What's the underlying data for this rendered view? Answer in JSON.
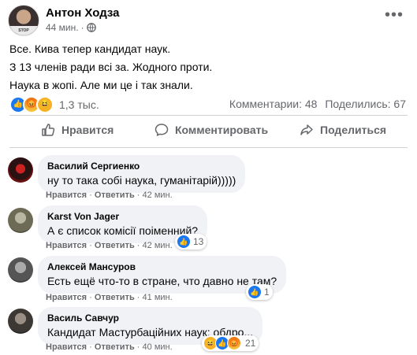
{
  "post": {
    "author": "Антон Ходза",
    "time": "44 мин.",
    "avatar_caption": "STOP TRANSPORT",
    "lines": [
      "Все. Кива тепер кандидат наук.",
      "З 13 членів ради всі за. Жодного проти.",
      "Наука в жопі. Але ми це і так знали."
    ],
    "reactions_count": "1,3 тыс.",
    "comments_count": "Комментарии: 48",
    "shares_count": "Поделились: 67",
    "actions": {
      "like": "Нравится",
      "comment": "Комментировать",
      "share": "Поделиться"
    }
  },
  "comment_actions": {
    "like": "Нравится",
    "sep": "·",
    "reply": "Ответить"
  },
  "comments": [
    {
      "name": "Василий Сергиенко",
      "text": "ну то така собі наука, гуманітарій)))))",
      "time": "42 мин.",
      "reactions": ""
    },
    {
      "name": "Karst Von Jager",
      "text": "А є список комісії поіменний?",
      "time": "42 мин.",
      "reactions": "13"
    },
    {
      "name": "Алексей Мансуров",
      "text": "Есть ещё что-то в стране, что давно не там?",
      "time": "41 мин.",
      "reactions": "1"
    },
    {
      "name": "Василь Савчур",
      "text": "Кандидат Мастурбаційних наук: обдро...",
      "time": "40 мин.",
      "reactions": "21"
    }
  ],
  "colors": {
    "like": "#1877f2",
    "meta_text": "#65676b",
    "bubble": "#f0f2f5"
  }
}
